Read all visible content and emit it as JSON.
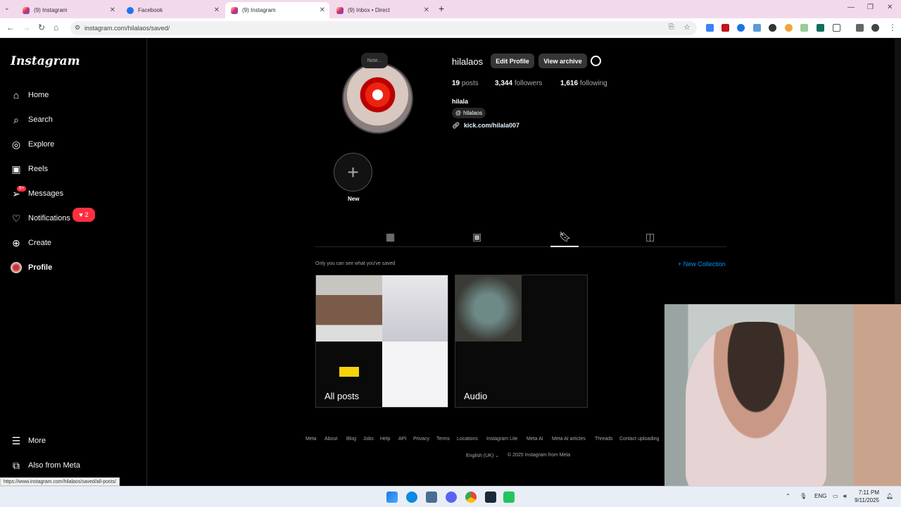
{
  "browser": {
    "tabs": [
      {
        "title": "(9) Instagram",
        "active": false
      },
      {
        "title": "Facebook",
        "active": false
      },
      {
        "title": "(9) Instagram",
        "active": true
      },
      {
        "title": "(9) Inbox • Direct",
        "active": false
      }
    ],
    "url": "instagram.com/hilalaos/saved/",
    "status_url": "https://www.instagram.com/hilalaos/saved/all-posts/"
  },
  "sidebar": {
    "logo": "Instagram",
    "items": [
      {
        "label": "Home",
        "icon": "home-icon"
      },
      {
        "label": "Search",
        "icon": "search-icon"
      },
      {
        "label": "Explore",
        "icon": "compass-icon"
      },
      {
        "label": "Reels",
        "icon": "reels-icon"
      },
      {
        "label": "Messages",
        "icon": "messenger-icon"
      },
      {
        "label": "Notifications",
        "icon": "heart-icon"
      },
      {
        "label": "Create",
        "icon": "plus-square-icon"
      },
      {
        "label": "Profile",
        "icon": "avatar"
      }
    ],
    "messages_badge": "9+",
    "notifications_count": "2",
    "more": "More",
    "also_from_meta": "Also from Meta"
  },
  "profile": {
    "note": "Note...",
    "username": "hilalaos",
    "edit_profile": "Edit Profile",
    "view_archive": "View archive",
    "posts_count": "19",
    "posts_label": "posts",
    "followers_count": "3,344",
    "followers_label": "followers",
    "following_count": "1,616",
    "following_label": "following",
    "full_name": "hilala",
    "threads_handle": "hilalaos",
    "link": "kick.com/hilala007",
    "new_highlight": "New"
  },
  "saved": {
    "note": "Only you can see what you've saved",
    "new_collection": "+ New Collection",
    "collections": [
      {
        "label": "All posts"
      },
      {
        "label": "Audio"
      }
    ]
  },
  "footer": {
    "links": [
      "Meta",
      "About",
      "Blog",
      "Jobs",
      "Help",
      "API",
      "Privacy",
      "Terms",
      "Locations",
      "Instagram Lite",
      "Meta AI",
      "Meta AI articles",
      "Threads",
      "Contact uploading"
    ],
    "language": "English (UK)",
    "copyright": "© 2025 Instagram from Meta"
  },
  "taskbar": {
    "lang": "ENG",
    "time": "7:11 PM",
    "date": "9/11/2025"
  },
  "colors": {
    "accent": "#0095f6",
    "badge": "#ff3040",
    "tab_bar": "#f3d9ec"
  }
}
